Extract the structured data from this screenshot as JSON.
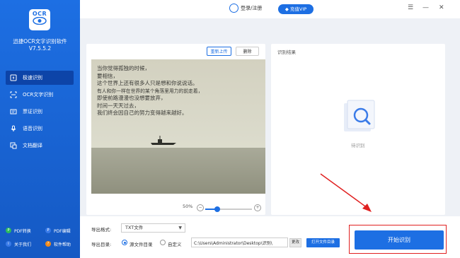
{
  "app": {
    "logo_text": "OCR",
    "name": "迅捷OCR文字识别软件",
    "version": "V7.5.5.2"
  },
  "sidebar": {
    "items": [
      {
        "label": "极速识别",
        "icon": "lightning-icon",
        "active": true
      },
      {
        "label": "OCR文字识别",
        "icon": "scan-icon",
        "active": false
      },
      {
        "label": "票证识别",
        "icon": "ticket-icon",
        "active": false
      },
      {
        "label": "语音识别",
        "icon": "microphone-icon",
        "active": false
      },
      {
        "label": "文档翻译",
        "icon": "translate-icon",
        "active": false
      }
    ],
    "bottom_links": [
      {
        "label": "PDF转换",
        "icon": "pdf-convert-icon",
        "color": "#2dbb5d"
      },
      {
        "label": "PDF编辑",
        "icon": "pdf-edit-icon",
        "color": "#3a7be8"
      },
      {
        "label": "关于我们",
        "icon": "info-icon",
        "color": "#3a7be8"
      },
      {
        "label": "软件帮助",
        "icon": "help-icon",
        "color": "#f08a1c"
      }
    ]
  },
  "topbar": {
    "login_label": "登录/注册",
    "vip_label": "充值VIP"
  },
  "left_panel": {
    "reupload_label": "重新上传",
    "delete_label": "删除",
    "zoom_percent": "50%",
    "zoom_value": 0.25,
    "image_text_lines": [
      "当你觉得孤独的时候，",
      "要相信，",
      "这个世界上还有很多人只是想和你说说话。",
      "有人和你一样在世界的某个角落里用力的前走着，",
      "即使前路漫漫也没想要放弃，",
      "时间一天天过去，",
      "我们终会因自己的努力变得越来越好。"
    ]
  },
  "right_panel": {
    "title": "识别结果",
    "waiting_label": "待识别"
  },
  "bottom": {
    "format_label": "导出格式:",
    "format_value": "TXT文件",
    "dir_label": "导出目录:",
    "radio_source_label": "源文件目录",
    "radio_custom_label": "自定义",
    "path_value": "C:\\Users\\Administrator\\Desktop\\识别\\",
    "change_label": "更改",
    "open_folder_label": "打开文件目录",
    "start_label": "开始识别"
  },
  "colors": {
    "brand": "#1d6fe3",
    "annotation": "#e02020"
  }
}
